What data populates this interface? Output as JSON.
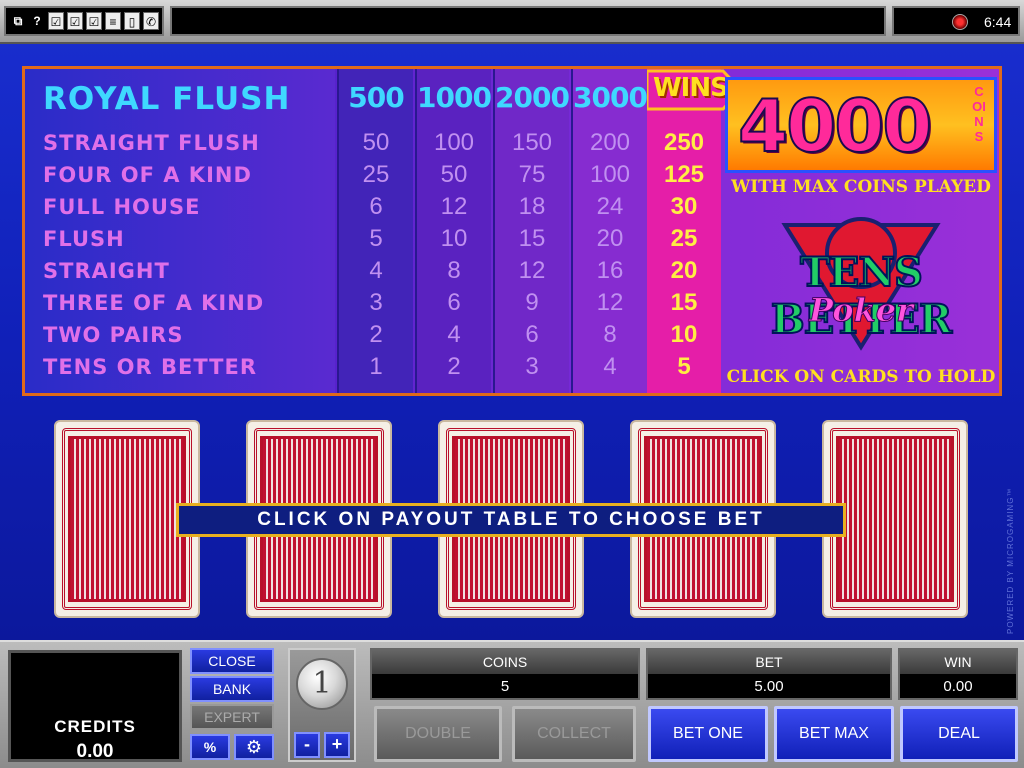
{
  "topbar": {
    "icons": [
      "window-icon",
      "help-icon",
      "checkbox-icon",
      "checkbox-icon",
      "checkbox-icon",
      "list-icon",
      "card-icon",
      "phone-icon"
    ],
    "help_symbol": "?",
    "time": "6:44"
  },
  "paytable": {
    "hands": [
      "ROYAL FLUSH",
      "STRAIGHT FLUSH",
      "FOUR OF A KIND",
      "FULL HOUSE",
      "FLUSH",
      "STRAIGHT",
      "THREE OF A KIND",
      "TWO PAIRS",
      "TENS OR BETTER"
    ],
    "columns": [
      {
        "header": "500",
        "values": [
          "50",
          "25",
          "6",
          "5",
          "4",
          "3",
          "2",
          "1"
        ]
      },
      {
        "header": "1000",
        "values": [
          "100",
          "50",
          "12",
          "10",
          "8",
          "6",
          "4",
          "2"
        ]
      },
      {
        "header": "2000",
        "values": [
          "150",
          "75",
          "18",
          "15",
          "12",
          "9",
          "6",
          "3"
        ]
      },
      {
        "header": "3000",
        "values": [
          "200",
          "100",
          "24",
          "20",
          "16",
          "12",
          "8",
          "4"
        ]
      },
      {
        "header": "WINS",
        "values": [
          "250",
          "125",
          "30",
          "25",
          "20",
          "15",
          "10",
          "5"
        ]
      }
    ],
    "jackpot_value": "4000",
    "jackpot_unit": "COINS",
    "max_coins_text": "WITH MAX COINS PLAYED",
    "logo_title": "TENS BETTER",
    "logo_sub": "Poker",
    "hold_message": "CLICK ON CARDS TO HOLD"
  },
  "banner": "CLICK ON PAYOUT TABLE TO CHOOSE BET",
  "powered_by": "POWERED BY MICROGAMING™",
  "bottom": {
    "credits_label": "CREDITS",
    "credits_value": "0.00",
    "close": "CLOSE",
    "bank": "BANK",
    "expert": "EXPERT",
    "percent": "%",
    "coin_value": "1",
    "minus": "-",
    "plus": "+",
    "coins_label": "COINS",
    "coins_value": "5",
    "bet_label": "BET",
    "bet_value": "5.00",
    "win_label": "WIN",
    "win_value": "0.00",
    "double": "DOUBLE",
    "collect": "COLLECT",
    "bet_one": "BET ONE",
    "bet_max": "BET MAX",
    "deal": "DEAL"
  },
  "colors": {
    "background": "#1a2fd0",
    "paytable_border": "#e06a1a",
    "hand_label": "#e070e8",
    "header": "#3fd8ff",
    "wins_column": "#e51ea8",
    "wins_text": "#ffee44",
    "card_back": "#c01030"
  }
}
